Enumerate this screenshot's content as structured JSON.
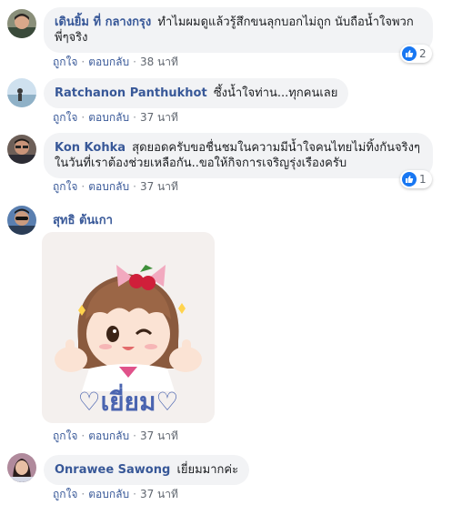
{
  "labels": {
    "like": "ถูกใจ",
    "reply": "ตอบกลับ",
    "separator": "·"
  },
  "colors": {
    "name": "#385898",
    "bubble": "#f2f3f5",
    "like_badge": "#1877f2",
    "meta": "#616770"
  },
  "comments": [
    {
      "author": "เดินยิ้ม ที่ กลางกรุง",
      "text": "ทำไมผมดูแล้วรู้สึกขนลุกบอกไม่ถูก นับถือน้ำใจพวกพี่ๆจริง",
      "time": "38 นาที",
      "reactions": "2",
      "avatar_icon": "profile-photo-man"
    },
    {
      "author": "Ratchanon Panthukhot",
      "text": "ซึ้งน้ำใจท่าน...ทุกคนเลย",
      "time": "37 นาที",
      "avatar_icon": "profile-photo-beach"
    },
    {
      "author": "Kon Kohka",
      "text": "สุดยอดครับขอชื่นชมในความมีน้ำใจคนไทยไม่ทิ้งกันจริงๆในวันที่เราต้องช่วยเหลือกัน..ขอให้กิจการเจริญรุ่งเรืองครับ",
      "time": "37 นาที",
      "reactions": "1",
      "avatar_icon": "profile-photo-man-glasses"
    },
    {
      "author": "สุทธิ ต้นเกา",
      "sticker_text": "♡เยี่ยม♡",
      "sticker_icon": "girl-thumbs-up-sticker",
      "time": "37 นาที",
      "avatar_icon": "profile-photo-man-sunglasses"
    },
    {
      "author": "Onrawee Sawong",
      "text": "เยี่ยมมากค่ะ",
      "time": "37 นาที",
      "avatar_icon": "profile-photo-woman"
    }
  ]
}
